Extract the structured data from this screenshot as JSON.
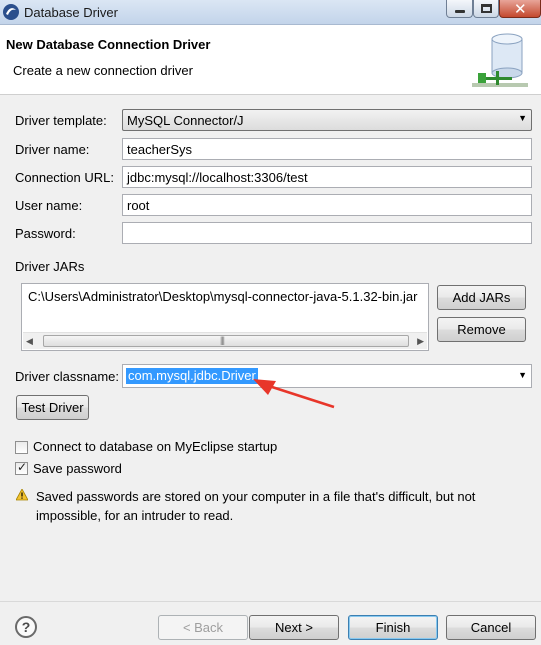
{
  "window": {
    "title": "Database Driver",
    "minimize_icon": "minimize-icon",
    "maximize_icon": "maximize-icon",
    "close_glyph": "✕"
  },
  "header": {
    "title": "New Database Connection Driver",
    "subtitle": "Create a new connection driver",
    "graphic": "database-driver-graphic"
  },
  "form": {
    "driver_template": {
      "label": "Driver template:",
      "value": "MySQL Connector/J"
    },
    "driver_name": {
      "label": "Driver name:",
      "value": "teacherSys"
    },
    "connection_url": {
      "label": "Connection URL:",
      "value": "jdbc:mysql://localhost:3306/test"
    },
    "user_name": {
      "label": "User name:",
      "value": "root"
    },
    "password": {
      "label": "Password:",
      "value": ""
    }
  },
  "driver_jars": {
    "label": "Driver JARs",
    "items": [
      "C:\\Users\\Administrator\\Desktop\\mysql-connector-java-5.1.32-bin.jar"
    ],
    "add_label": "Add JARs",
    "remove_label": "Remove"
  },
  "driver_classname": {
    "label": "Driver classname:",
    "value": "com.mysql.jdbc.Driver"
  },
  "test_driver_label": "Test Driver",
  "options": {
    "connect_on_startup": {
      "label": "Connect to database on MyEclipse startup",
      "checked": false
    },
    "save_password": {
      "label": "Save password",
      "checked": true
    }
  },
  "warning": {
    "text": "Saved passwords are stored on your computer in a file that's difficult, but not impossible, for an intruder to read.",
    "icon": "warning-icon"
  },
  "footer": {
    "help_glyph": "?",
    "back_label": "< Back",
    "next_label": "Next >",
    "finish_label": "Finish",
    "cancel_label": "Cancel"
  },
  "colors": {
    "selection": "#3399ff",
    "annotation_arrow": "#e8362a",
    "header_bg": "#ffffff",
    "dialog_bg": "#f0f0f0"
  }
}
